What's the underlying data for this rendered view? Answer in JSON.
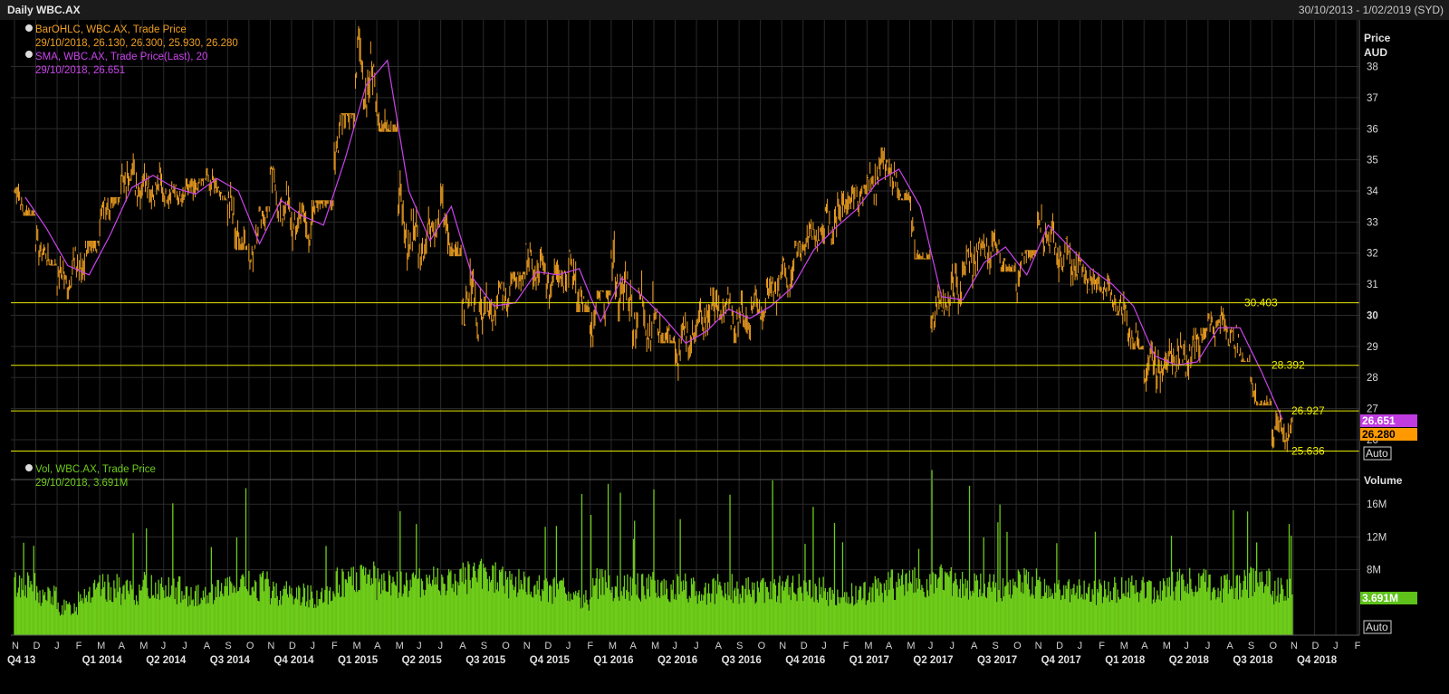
{
  "header": {
    "title": "Daily WBC.AX",
    "date_range": "30/10/2013 - 1/02/2019 (SYD)"
  },
  "price_panel": {
    "legend_ohlc": "BarOHLC, WBC.AX, Trade Price",
    "legend_ohlc_values": "29/10/2018, 26.130, 26.300, 25.930, 26.280",
    "legend_sma": "SMA, WBC.AX, Trade Price(Last),  20",
    "legend_sma_values": "29/10/2018, 26.651",
    "axis_title_1": "Price",
    "axis_title_2": "AUD",
    "y_ticks": [
      "38",
      "37",
      "36",
      "35",
      "34",
      "33",
      "32",
      "31",
      "30",
      "29",
      "28",
      "27",
      "26"
    ],
    "sma_tag": "26.651",
    "last_tag": "26.280",
    "auto_label": "Auto"
  },
  "volume_panel": {
    "legend": "Vol, WBC.AX, Trade Price",
    "legend_values": "29/10/2018, 3.691M",
    "axis_title": "Volume",
    "y_ticks": [
      "16M",
      "12M",
      "8M"
    ],
    "last_tag": "3.691M",
    "auto_label": "Auto"
  },
  "colors": {
    "background": "#000000",
    "panel_bg": "#000000",
    "grid": "#2b2b2b",
    "ohlc": "#f0a020",
    "sma": "#cc44ee",
    "volume": "#6ecc1a",
    "hline": "#e8e800",
    "sma_tag_bg": "#c03ce0",
    "last_tag_bg": "#ff9900",
    "vol_tag_bg": "#5ec21a"
  },
  "x_axis": {
    "months": [
      "N",
      "D",
      "J",
      "F",
      "M",
      "A",
      "M",
      "J",
      "J",
      "A",
      "S",
      "O",
      "N",
      "D",
      "J",
      "F",
      "M",
      "A",
      "M",
      "J",
      "J",
      "A",
      "S",
      "O",
      "N",
      "D",
      "J",
      "F",
      "M",
      "A",
      "M",
      "J",
      "J",
      "A",
      "S",
      "O",
      "N",
      "D",
      "J",
      "F",
      "M",
      "A",
      "M",
      "J",
      "J",
      "A",
      "S",
      "O",
      "N",
      "D",
      "J",
      "F",
      "M",
      "A",
      "M",
      "J",
      "J",
      "A",
      "S",
      "O",
      "N",
      "D",
      "J",
      "F"
    ],
    "quarters": [
      "Q4 13",
      "Q1 2014",
      "Q2 2014",
      "Q3 2014",
      "Q4 2014",
      "Q1 2015",
      "Q2 2015",
      "Q3 2015",
      "Q4 2015",
      "Q1 2016",
      "Q2 2016",
      "Q3 2016",
      "Q4 2016",
      "Q1 2017",
      "Q2 2017",
      "Q3 2017",
      "Q4 2017",
      "Q1 2018",
      "Q2 2018",
      "Q3 2018",
      "Q4 2018"
    ]
  },
  "chart_data": [
    {
      "type": "line",
      "title": "",
      "ylabel": "Price AUD",
      "ylim": [
        25.3,
        39.5
      ],
      "x_range": [
        "30/10/2013",
        "1/02/2019"
      ],
      "series": [
        {
          "name": "BarOHLC, WBC.AX, Trade Price",
          "style": "ohlc-bars",
          "dates": [
            "2013-11",
            "2013-12",
            "2014-01",
            "2014-02",
            "2014-03",
            "2014-04",
            "2014-05",
            "2014-06",
            "2014-07",
            "2014-08",
            "2014-09",
            "2014-10",
            "2014-11",
            "2014-12",
            "2015-01",
            "2015-02",
            "2015-03",
            "2015-04",
            "2015-05",
            "2015-06",
            "2015-07",
            "2015-08",
            "2015-09",
            "2015-10",
            "2015-11",
            "2015-12",
            "2016-01",
            "2016-02",
            "2016-03",
            "2016-04",
            "2016-05",
            "2016-06",
            "2016-07",
            "2016-08",
            "2016-09",
            "2016-10",
            "2016-11",
            "2016-12",
            "2017-01",
            "2017-02",
            "2017-03",
            "2017-04",
            "2017-05",
            "2017-06",
            "2017-07",
            "2017-08",
            "2017-09",
            "2017-10",
            "2017-11",
            "2017-12",
            "2018-01",
            "2018-02",
            "2018-03",
            "2018-04",
            "2018-05",
            "2018-06",
            "2018-07",
            "2018-08",
            "2018-09",
            "2018-10"
          ],
          "close": [
            34.0,
            32.5,
            31.0,
            31.5,
            33.0,
            34.5,
            34.3,
            34.0,
            33.8,
            34.6,
            33.5,
            31.8,
            34.2,
            33.0,
            33.0,
            35.5,
            38.0,
            37.2,
            33.2,
            32.2,
            33.3,
            30.8,
            30.2,
            30.6,
            31.7,
            31.2,
            31.6,
            29.5,
            31.4,
            30.3,
            29.8,
            28.8,
            29.6,
            30.4,
            29.8,
            30.4,
            31.0,
            32.4,
            32.7,
            33.5,
            34.3,
            34.8,
            33.0,
            30.2,
            30.6,
            31.9,
            32.3,
            31.0,
            33.1,
            32.0,
            31.4,
            30.9,
            30.1,
            28.4,
            28.5,
            28.7,
            29.8,
            29.6,
            27.8,
            26.3
          ],
          "high": [
            34.8,
            33.2,
            32.4,
            32.4,
            33.8,
            35.8,
            35.2,
            34.5,
            34.4,
            35.1,
            34.9,
            33.5,
            34.8,
            34.2,
            33.7,
            36.5,
            39.3,
            38.6,
            35.0,
            33.5,
            34.9,
            32.3,
            31.2,
            31.4,
            32.9,
            32.6,
            33.7,
            30.8,
            33.4,
            31.8,
            31.1,
            30.1,
            30.9,
            31.2,
            31.0,
            31.4,
            32.4,
            33.1,
            34.0,
            34.2,
            35.4,
            35.3,
            34.5,
            31.4,
            32.4,
            32.8,
            33.1,
            32.1,
            33.7,
            33.1,
            31.8,
            31.5,
            31.1,
            30.3,
            29.6,
            29.6,
            30.4,
            30.4,
            28.7,
            27.4
          ],
          "low": [
            33.2,
            31.6,
            30.1,
            29.8,
            31.9,
            33.4,
            33.4,
            33.3,
            32.8,
            33.7,
            32.1,
            31.2,
            32.3,
            31.6,
            32.2,
            33.3,
            35.5,
            35.9,
            31.4,
            31.0,
            31.9,
            29.0,
            29.1,
            29.6,
            30.4,
            30.2,
            30.1,
            27.9,
            29.8,
            28.2,
            29.1,
            27.6,
            28.5,
            29.1,
            28.6,
            29.0,
            30.0,
            31.4,
            31.5,
            32.1,
            33.1,
            33.7,
            31.8,
            29.4,
            29.8,
            31.0,
            31.4,
            30.4,
            31.2,
            30.8,
            30.5,
            30.0,
            28.9,
            27.5,
            27.3,
            27.2,
            28.9,
            28.5,
            27.1,
            25.6
          ]
        },
        {
          "name": "SMA, WBC.AX, Trade Price(Last),  20",
          "style": "line",
          "dates": [
            "2013-11",
            "2013-12",
            "2014-01",
            "2014-02",
            "2014-03",
            "2014-04",
            "2014-05",
            "2014-06",
            "2014-07",
            "2014-08",
            "2014-09",
            "2014-10",
            "2014-11",
            "2014-12",
            "2015-01",
            "2015-02",
            "2015-03",
            "2015-04",
            "2015-05",
            "2015-06",
            "2015-07",
            "2015-08",
            "2015-09",
            "2015-10",
            "2015-11",
            "2015-12",
            "2016-01",
            "2016-02",
            "2016-03",
            "2016-04",
            "2016-05",
            "2016-06",
            "2016-07",
            "2016-08",
            "2016-09",
            "2016-10",
            "2016-11",
            "2016-12",
            "2017-01",
            "2017-02",
            "2017-03",
            "2017-04",
            "2017-05",
            "2017-06",
            "2017-07",
            "2017-08",
            "2017-09",
            "2017-10",
            "2017-11",
            "2017-12",
            "2018-01",
            "2018-02",
            "2018-03",
            "2018-04",
            "2018-05",
            "2018-06",
            "2018-07",
            "2018-08",
            "2018-09",
            "2018-10"
          ],
          "values": [
            33.8,
            32.8,
            31.6,
            31.3,
            32.6,
            34.1,
            34.5,
            34.1,
            33.9,
            34.4,
            34.0,
            32.3,
            33.7,
            33.2,
            32.9,
            35.0,
            37.4,
            38.2,
            34.0,
            32.4,
            33.5,
            31.2,
            30.3,
            30.4,
            31.4,
            31.3,
            31.5,
            29.8,
            31.2,
            30.6,
            29.9,
            29.1,
            29.5,
            30.2,
            29.9,
            30.3,
            30.9,
            32.1,
            32.8,
            33.4,
            34.3,
            34.7,
            33.5,
            30.6,
            30.5,
            31.7,
            32.2,
            31.3,
            32.9,
            32.2,
            31.5,
            31.0,
            30.3,
            28.7,
            28.4,
            28.5,
            29.6,
            29.6,
            28.2,
            26.65
          ]
        }
      ],
      "horizontal_lines": [
        30.403,
        28.392,
        26.927,
        25.636
      ],
      "last_close": 26.28,
      "last_sma": 26.651,
      "grid": true,
      "legend": "top-left"
    },
    {
      "type": "bar",
      "title": "",
      "ylabel": "Volume",
      "ylim": [
        0,
        21
      ],
      "unit": "M",
      "series": [
        {
          "name": "Vol, WBC.AX, Trade Price",
          "dates": [
            "2013-11",
            "2013-12",
            "2014-01",
            "2014-02",
            "2014-03",
            "2014-04",
            "2014-05",
            "2014-06",
            "2014-07",
            "2014-08",
            "2014-09",
            "2014-10",
            "2014-11",
            "2014-12",
            "2015-01",
            "2015-02",
            "2015-03",
            "2015-04",
            "2015-05",
            "2015-06",
            "2015-07",
            "2015-08",
            "2015-09",
            "2015-10",
            "2015-11",
            "2015-12",
            "2016-01",
            "2016-02",
            "2016-03",
            "2016-04",
            "2016-05",
            "2016-06",
            "2016-07",
            "2016-08",
            "2016-09",
            "2016-10",
            "2016-11",
            "2016-12",
            "2017-01",
            "2017-02",
            "2017-03",
            "2017-04",
            "2017-05",
            "2017-06",
            "2017-07",
            "2017-08",
            "2017-09",
            "2017-10",
            "2017-11",
            "2017-12",
            "2018-01",
            "2018-02",
            "2018-03",
            "2018-04",
            "2018-05",
            "2018-06",
            "2018-07",
            "2018-08",
            "2018-09",
            "2018-10"
          ],
          "values": [
            6.5,
            5.0,
            3.5,
            5.5,
            6.0,
            5.5,
            6.2,
            5.8,
            5.0,
            5.7,
            6.0,
            6.3,
            5.5,
            5.2,
            4.8,
            6.8,
            7.2,
            6.6,
            6.5,
            7.0,
            6.8,
            7.5,
            7.2,
            6.8,
            6.0,
            5.8,
            4.6,
            6.6,
            6.4,
            6.2,
            6.0,
            6.1,
            5.6,
            6.0,
            5.8,
            5.9,
            6.0,
            5.8,
            5.0,
            5.3,
            6.0,
            6.6,
            6.8,
            7.3,
            6.2,
            6.4,
            6.0,
            6.6,
            6.0,
            5.6,
            5.5,
            5.8,
            6.2,
            5.8,
            6.5,
            6.8,
            6.0,
            6.5,
            6.8,
            5.8
          ]
        }
      ],
      "last_value": 3.691,
      "grid": true,
      "legend": "top-left"
    }
  ]
}
